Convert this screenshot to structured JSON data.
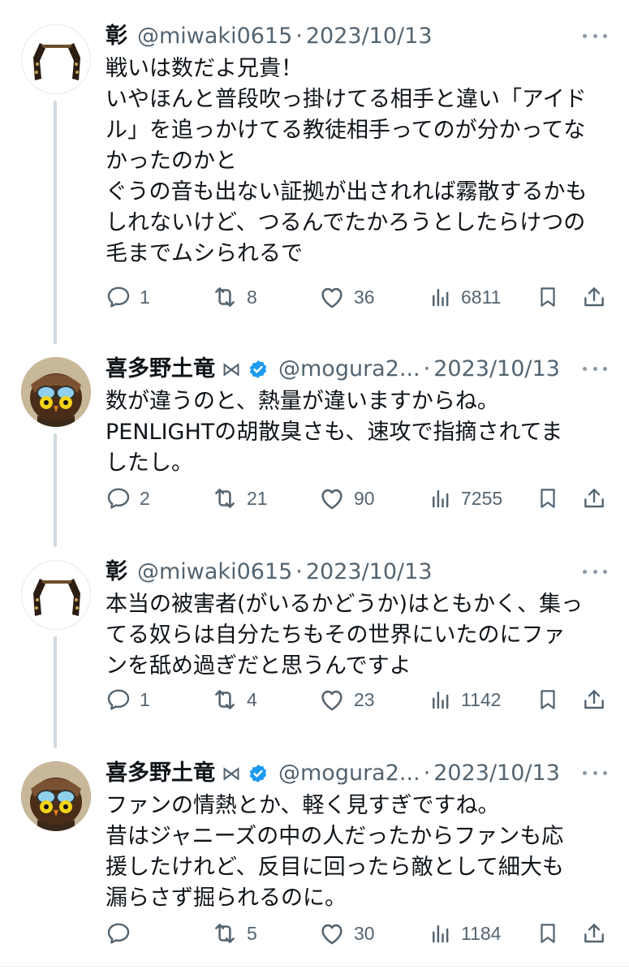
{
  "tweets": [
    {
      "display_name": "彰",
      "handle": "@miwaki0615",
      "dot": "·",
      "date": "2023/10/13",
      "avatar": "glasses-avatar",
      "lines": [
        "戦いは数だよ兄貴！",
        "いやほんと普段吹っ掛けてる相手と違い「アイド",
        "ル」を追っかけてる教徒相手ってのが分かってな",
        "かったのかと",
        "ぐうの音も出ない証拠が出されれば霧散するかも",
        "しれないけど、つるんでたかろうとしたらけつの",
        "毛までムシられるで"
      ],
      "stats": {
        "replies": "1",
        "retweets": "8",
        "likes": "36",
        "views": "6811"
      }
    },
    {
      "display_name": "喜多野土竜",
      "blocked_icon": "⋈",
      "handle": "@mogura2...",
      "dot": "·",
      "date": "2023/10/13",
      "avatar": "owl-avatar",
      "lines": [
        "数が違うのと、熱量が違いますからね。",
        "PENLIGHTの胡散臭さも、速攻で指摘されてま",
        "したし。"
      ],
      "stats": {
        "replies": "2",
        "retweets": "21",
        "likes": "90",
        "views": "7255"
      }
    },
    {
      "display_name": "彰",
      "handle": "@miwaki0615",
      "dot": "·",
      "date": "2023/10/13",
      "avatar": "glasses-avatar",
      "lines": [
        "本当の被害者(がいるかどうか)はともかく、集っ",
        "てる奴らは自分たちもその世界にいたのにファ",
        "ンを舐め過ぎだと思うんですよ"
      ],
      "stats": {
        "replies": "1",
        "retweets": "4",
        "likes": "23",
        "views": "1142"
      }
    },
    {
      "display_name": "喜多野土竜",
      "blocked_icon": "⋈",
      "handle": "@mogura2...",
      "dot": "·",
      "date": "2023/10/13",
      "avatar": "owl-avatar",
      "lines": [
        "ファンの情熱とか、軽く見すぎですね。",
        "昔はジャニーズの中の人だったからファンも応",
        "援したけれど、反目に回ったら敵として細大も",
        "漏らさず掘られるのに。"
      ],
      "stats": {
        "replies": "",
        "retweets": "5",
        "likes": "30",
        "views": "1184"
      }
    }
  ],
  "icons": {
    "reply": "speech-bubble-icon",
    "retweet": "retweet-arrows-icon",
    "like": "heart-icon",
    "views": "bar-chart-icon",
    "bookmark": "bookmark-icon",
    "share": "share-upload-icon",
    "more": "more-dots-icon",
    "verified": "verified-check-icon"
  },
  "colors": {
    "text": "#0f1419",
    "muted": "#536471",
    "verified": "#1d9bf0",
    "thread_line": "#cfd9de"
  }
}
